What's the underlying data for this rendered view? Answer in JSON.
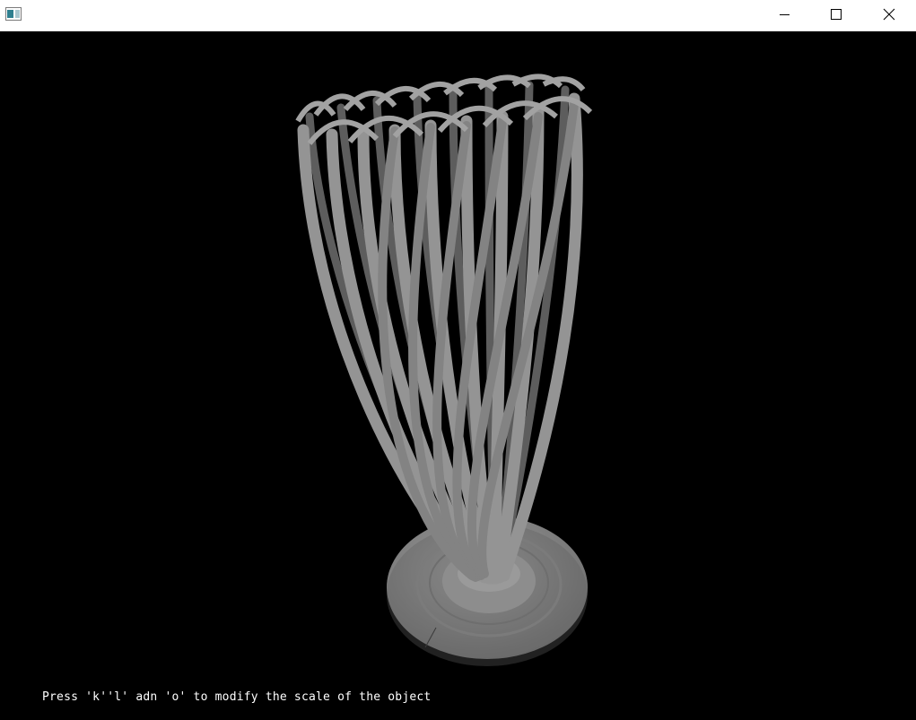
{
  "window": {
    "title": "",
    "icon": "app-window-icon",
    "controls": {
      "minimize_icon": "minimize-icon",
      "maximize_icon": "maximize-icon",
      "close_icon": "close-icon"
    }
  },
  "viewport": {
    "background": "#000000",
    "object": "vase-3d-model",
    "object_color": "#8a8a8a",
    "hint_text": "Press 'k''l' adn 'o' to modify the scale of the object"
  }
}
